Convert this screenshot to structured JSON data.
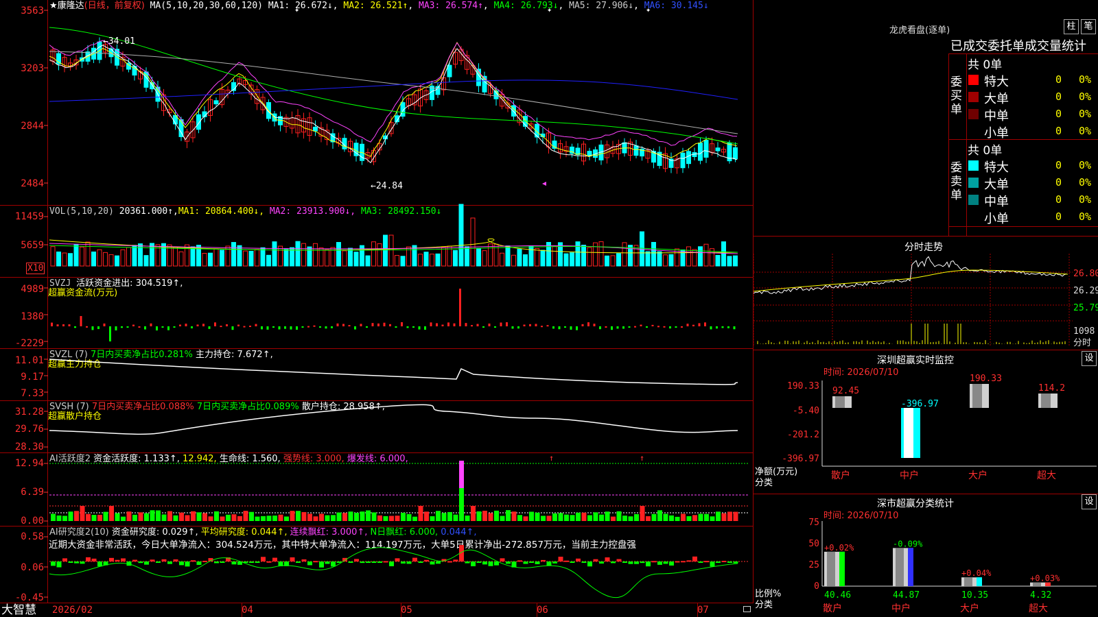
{
  "colors": {
    "up": "#ff2020",
    "down": "#00ffff",
    "grid": "#a00000",
    "ma5": "#ffffff",
    "ma10": "#ffff00",
    "ma20": "#ff44ff",
    "ma30": "#00ff00",
    "ma60": "#b0b0b0",
    "ma120": "#2020ff"
  },
  "header": {
    "icon": "star-icon",
    "stock": "★康隆达",
    "period": "(日线，前复权)",
    "ma_label": "MA(5,10,20,30,60,120)",
    "ma1": "MA1: 26.672↓",
    "ma2": "MA2: 26.521↑",
    "ma3": "MA3: 26.574↑",
    "ma4": "MA4: 26.793↓",
    "ma5": "MA5: 27.906↓",
    "ma6": "MA6: 30.145↓"
  },
  "price_axis": [
    "3563",
    "3203",
    "2844",
    "2484"
  ],
  "price_marks": {
    "high": "←34.01",
    "low": "←24.84"
  },
  "vol": {
    "label": "VOL(5,10,20)",
    "value": "20361.000↑,",
    "ma1": "MA1: 20864.400↓,",
    "ma2": "MA2: 23913.900↓,",
    "ma3": "MA3: 28492.150↓",
    "axis": [
      "11459",
      "5659"
    ],
    "unit": "X10"
  },
  "svzj": {
    "label": "SVZJ",
    "desc": "活跃资金进出: 304.519↑,",
    "name": "超赢资金流(万元)",
    "axis": [
      "4989",
      "1380",
      "-2229"
    ]
  },
  "svzl": {
    "label": "SVZL (7)",
    "desc1": "7日内买卖净占比0.281%",
    "desc2": "主力持仓: 7.672↑,",
    "name": "超赢主力持仓",
    "axis": [
      "11.01",
      "9.17",
      "7.33"
    ]
  },
  "svsh": {
    "label": "SVSH (7)",
    "desc1": "7日内买卖净占比0.088%",
    "desc2": "7日内买卖净占比0.089%",
    "desc3": "散户持仓: 28.958↑,",
    "name": "超赢散户持仓",
    "axis": [
      "31.28",
      "29.76",
      "28.30"
    ]
  },
  "ai2": {
    "label": "AI活跃度2",
    "desc1": "资金活跃度: 1.133↑,",
    "desc2": "12.942,",
    "desc3": "生命线: 1.560,",
    "desc4": "强势线: 3.000,",
    "desc5": "爆发线: 6.000,",
    "axis": [
      "12.94",
      "6.39",
      "0.00"
    ]
  },
  "ai_research": {
    "label": "AI研究度2(10)",
    "desc1": "资金研究度: 0.029↑,",
    "desc2": "平均研究度: 0.044↑,",
    "desc3": "连续飘红: 3.000↑,",
    "desc4": "N日飘红: 6.000,",
    "desc5": "0.044↑,",
    "comment": "近期大资金非常活跃，今日大单净流入：304.524万元，其中特大单净流入：114.197万元，大单5日累计净出-272.857万元，当前主力控盘强",
    "axis": [
      "0.58",
      "0.06",
      "-0.45"
    ]
  },
  "date_axis": {
    "labels": [
      "2026/02",
      "04",
      "05",
      "06",
      "07"
    ],
    "brand": "大智慧"
  },
  "right": {
    "lh_title": "龙虎看盘(逐单)",
    "btn_bar": "柱",
    "btn_pen": "笔",
    "order_title": "已成交委托单成交量统计",
    "buy_label": "委买单",
    "sell_label": "委卖单",
    "buy_total": "共 0单",
    "sell_total": "共 0单",
    "buy_rows": [
      {
        "name": "特大",
        "count": "0",
        "pct": "0%",
        "color": "#ff0000"
      },
      {
        "name": "大单",
        "count": "0",
        "pct": "0%",
        "color": "#a00000"
      },
      {
        "name": "中单",
        "count": "0",
        "pct": "0%",
        "color": "#700000"
      },
      {
        "name": "小单",
        "count": "0",
        "pct": "0%",
        "color": "#000000"
      }
    ],
    "sell_rows": [
      {
        "name": "特大",
        "count": "0",
        "pct": "0%",
        "color": "#00ffff"
      },
      {
        "name": "大单",
        "count": "0",
        "pct": "0%",
        "color": "#00a0a0"
      },
      {
        "name": "中单",
        "count": "0",
        "pct": "0%",
        "color": "#008080"
      },
      {
        "name": "小单",
        "count": "0",
        "pct": "0%",
        "color": "#000000"
      }
    ],
    "intraday_title": "分时走势",
    "intraday_axis": [
      "26.80",
      "26.29",
      "25.79"
    ],
    "intraday_vol": "1098",
    "intraday_unit": "分时",
    "monitor_title": "深圳超赢实时监控",
    "settings": "设",
    "time": "时间: 2026/07/10",
    "monitor_axis": [
      "190.33",
      "-5.40",
      "-201.2",
      "-396.97"
    ],
    "monitor_ylabel": "净额(万元)",
    "monitor_xlabel": "分类",
    "monitor_bars": [
      {
        "cat": "散户",
        "value": "92.45",
        "num": 92.45
      },
      {
        "cat": "中户",
        "value": "-396.97",
        "num": -396.97
      },
      {
        "cat": "大户",
        "value": "190.33",
        "num": 190.33
      },
      {
        "cat": "超大",
        "value": "114.2",
        "num": 114.2
      }
    ],
    "stats_title": "深市超赢分类统计",
    "stats_time": "时间: 2026/07/10",
    "stats_axis": [
      "75",
      "50",
      "25",
      "0"
    ],
    "stats_ylabel": "比例%",
    "stats_xlabel": "分类",
    "stats_bars": [
      {
        "cat": "散户",
        "value": "40.46",
        "num": 40.46,
        "chg": "+0.02%"
      },
      {
        "cat": "中户",
        "value": "44.87",
        "num": 44.87,
        "chg": "-0.09%"
      },
      {
        "cat": "大户",
        "value": "10.35",
        "num": 10.35,
        "chg": "+0.04%"
      },
      {
        "cat": "超大",
        "value": "4.32",
        "num": 4.32,
        "chg": "+0.03%"
      }
    ]
  }
}
